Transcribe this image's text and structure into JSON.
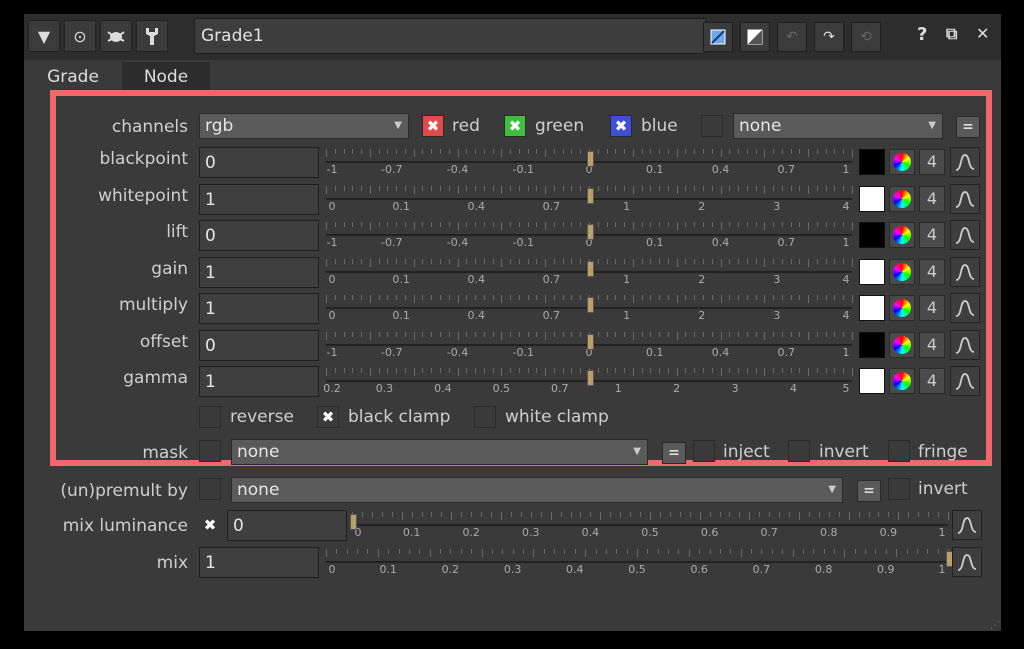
{
  "titlebar": {
    "node_name": "Grade1",
    "buttons": [
      "collapse-icon",
      "viewer-icon",
      "bug-icon",
      "wrench-icon"
    ],
    "right_buttons": [
      "input-swatch-icon",
      "output-swatch-icon",
      "undo-icon",
      "redo-icon",
      "revert-icon"
    ],
    "help": "?",
    "float": "⧉",
    "close": "✕"
  },
  "tabs": [
    {
      "label": "Grade",
      "active": true
    },
    {
      "label": "Node",
      "active": false
    }
  ],
  "channels": {
    "label": "channels",
    "value": "rgb",
    "red": "red",
    "green": "green",
    "blue": "blue",
    "extra": "none",
    "colors": {
      "red": "#e24a4a",
      "green": "#3fbf3f",
      "blue": "#3d4fd6"
    }
  },
  "params": [
    {
      "label": "blackpoint",
      "value": "0",
      "scale": "a",
      "swatch": "#000000",
      "knob": 0.5
    },
    {
      "label": "whitepoint",
      "value": "1",
      "scale": "b",
      "swatch": "#ffffff",
      "knob": 0.5
    },
    {
      "label": "lift",
      "value": "0",
      "scale": "a",
      "swatch": "#000000",
      "knob": 0.5
    },
    {
      "label": "gain",
      "value": "1",
      "scale": "b",
      "swatch": "#ffffff",
      "knob": 0.5
    },
    {
      "label": "multiply",
      "value": "1",
      "scale": "b",
      "swatch": "#ffffff",
      "knob": 0.5
    },
    {
      "label": "offset",
      "value": "0",
      "scale": "a",
      "swatch": "#000000",
      "knob": 0.5
    },
    {
      "label": "gamma",
      "value": "1",
      "scale": "c",
      "swatch": "#ffffff",
      "knob": 0.5
    }
  ],
  "scales": {
    "a": [
      "-1",
      "-0.7",
      "-0.4",
      "-0.1",
      "0",
      "0.1",
      "0.4",
      "0.7",
      "1"
    ],
    "b": [
      "0",
      "0.1",
      "0.4",
      "0.7",
      "1",
      "2",
      "3",
      "4"
    ],
    "c": [
      "0.2",
      "0.3",
      "0.4",
      "0.5",
      "0.7",
      "1",
      "2",
      "3",
      "4",
      "5"
    ],
    "d": [
      "0",
      "0.1",
      "0.2",
      "0.3",
      "0.4",
      "0.5",
      "0.6",
      "0.7",
      "0.8",
      "0.9",
      "1"
    ]
  },
  "channel_count": "4",
  "clamps": {
    "reverse": "reverse",
    "black_clamp": "black clamp",
    "white_clamp": "white clamp"
  },
  "mask": {
    "label": "mask",
    "value": "none",
    "inject": "inject",
    "invert": "invert",
    "fringe": "fringe"
  },
  "premult": {
    "label": "(un)premult by",
    "value": "none",
    "invert": "invert"
  },
  "mix_luminance": {
    "label": "mix luminance",
    "value": "0",
    "knob": 0.0
  },
  "mix": {
    "label": "mix",
    "value": "1",
    "knob": 1.0
  },
  "highlight_color": "#f0686c"
}
